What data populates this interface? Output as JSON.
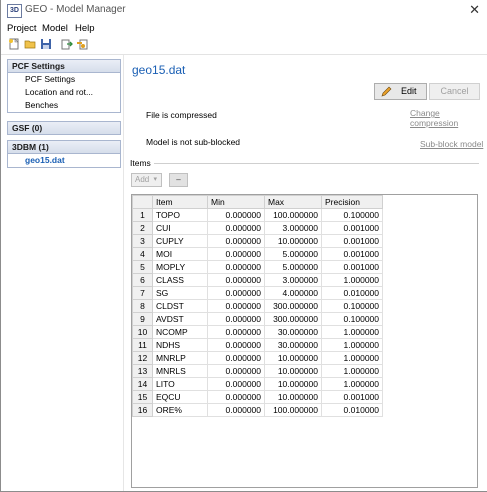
{
  "window": {
    "title": "GEO - Model Manager",
    "app_icon_text": "3D",
    "close_glyph": "✕"
  },
  "menu": [
    "Project",
    "Model",
    "Help"
  ],
  "sidebar": {
    "pcf": {
      "header": "PCF Settings",
      "items": [
        "PCF Settings",
        "Location and rot...",
        "Benches"
      ]
    },
    "gsf": {
      "header": "GSF (0)"
    },
    "dbm": {
      "header": "3DBM (1)",
      "items": [
        "geo15.dat"
      ]
    }
  },
  "main": {
    "file_title": "geo15.dat",
    "edit_label": "Edit",
    "cancel_label": "Cancel",
    "compressed_text": "File is compressed",
    "change_compression_link": "Change compression",
    "subblocked_text": "Model is not sub-blocked",
    "subblock_link": "Sub-block model",
    "items_label": "Items",
    "add_label": "Add",
    "remove_label": "–"
  },
  "table": {
    "headers": [
      "Item",
      "Min",
      "Max",
      "Precision"
    ],
    "rows": [
      {
        "n": "1",
        "item": "TOPO",
        "min": "0.000000",
        "max": "100.000000",
        "prec": "0.100000"
      },
      {
        "n": "2",
        "item": "CUI",
        "min": "0.000000",
        "max": "3.000000",
        "prec": "0.001000"
      },
      {
        "n": "3",
        "item": "CUPLY",
        "min": "0.000000",
        "max": "10.000000",
        "prec": "0.001000"
      },
      {
        "n": "4",
        "item": "MOI",
        "min": "0.000000",
        "max": "5.000000",
        "prec": "0.001000"
      },
      {
        "n": "5",
        "item": "MOPLY",
        "min": "0.000000",
        "max": "5.000000",
        "prec": "0.001000"
      },
      {
        "n": "6",
        "item": "CLASS",
        "min": "0.000000",
        "max": "3.000000",
        "prec": "1.000000"
      },
      {
        "n": "7",
        "item": "SG",
        "min": "0.000000",
        "max": "4.000000",
        "prec": "0.010000"
      },
      {
        "n": "8",
        "item": "CLDST",
        "min": "0.000000",
        "max": "300.000000",
        "prec": "0.100000"
      },
      {
        "n": "9",
        "item": "AVDST",
        "min": "0.000000",
        "max": "300.000000",
        "prec": "0.100000"
      },
      {
        "n": "10",
        "item": "NCOMP",
        "min": "0.000000",
        "max": "30.000000",
        "prec": "1.000000"
      },
      {
        "n": "11",
        "item": "NDHS",
        "min": "0.000000",
        "max": "30.000000",
        "prec": "1.000000"
      },
      {
        "n": "12",
        "item": "MNRLP",
        "min": "0.000000",
        "max": "10.000000",
        "prec": "1.000000"
      },
      {
        "n": "13",
        "item": "MNRLS",
        "min": "0.000000",
        "max": "10.000000",
        "prec": "1.000000"
      },
      {
        "n": "14",
        "item": "LITO",
        "min": "0.000000",
        "max": "10.000000",
        "prec": "1.000000"
      },
      {
        "n": "15",
        "item": "EQCU",
        "min": "0.000000",
        "max": "10.000000",
        "prec": "0.001000"
      },
      {
        "n": "16",
        "item": "ORE%",
        "min": "0.000000",
        "max": "100.000000",
        "prec": "0.010000"
      }
    ]
  }
}
